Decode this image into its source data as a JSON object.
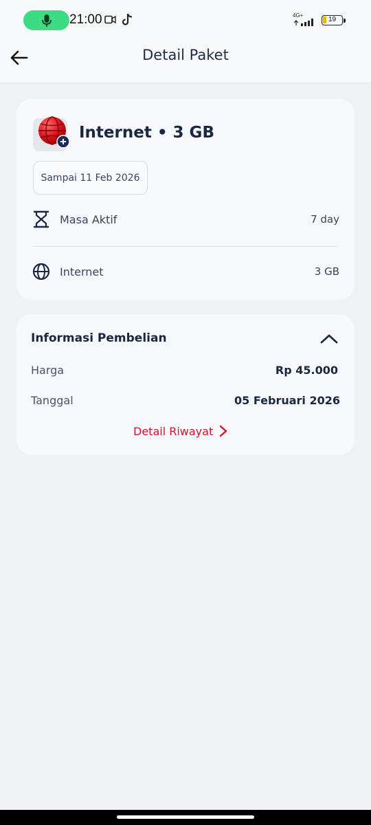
{
  "status_bar": {
    "time": "21:00",
    "network": "4G+",
    "battery": "19",
    "icons": [
      "mic-icon",
      "video-icon",
      "tiktok-icon",
      "signal-icon",
      "battery-icon"
    ]
  },
  "header": {
    "title": "Detail Paket",
    "back_icon": "arrow-left-icon"
  },
  "package": {
    "title": "Internet • 3 GB",
    "icon": "globe-plus-icon",
    "valid_until": "Sampai 11 Feb 2026",
    "rows": [
      {
        "label": "Masa Aktif",
        "value": "7 day",
        "icon": "hourglass-icon"
      },
      {
        "label": "Internet",
        "value": "3 GB",
        "icon": "globe-icon"
      }
    ]
  },
  "purchase": {
    "title": "Informasi Pembelian",
    "price_label": "Harga",
    "price_value": "Rp 45.000",
    "date_label": "Tanggal",
    "date_value": "05 Februari 2026",
    "history_link": "Detail Riwayat"
  },
  "colors": {
    "accent": "#d4122b",
    "text_primary": "#1a2740",
    "background": "#eff1f5",
    "card": "#f7f8fb"
  }
}
